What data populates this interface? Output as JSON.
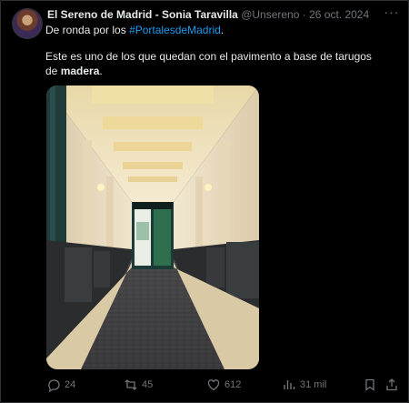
{
  "tweet": {
    "author_name": "El Sereno de Madrid - Sonia Taravilla",
    "handle": "@Unsereno",
    "separator": "·",
    "date": "26 oct. 2024",
    "more_label": "···",
    "line1_prefix": "De ronda por los ",
    "line1_hashtag": "#PortalesdeMadrid",
    "line1_suffix": ".",
    "line2_text": "Este es uno de los que quedan con el pavimento a base de tarugos de ",
    "line2_bold": "madera",
    "line2_suffix": "."
  },
  "actions": {
    "replies": "24",
    "reposts": "45",
    "likes": "612",
    "views": "31 mil"
  },
  "colors": {
    "background": "#000000",
    "text": "#e7e9ea",
    "muted": "#71767b",
    "link": "#1d9bf0"
  },
  "icons": [
    "reply-icon",
    "repost-icon",
    "like-icon",
    "views-icon",
    "bookmark-icon",
    "share-icon",
    "more-icon"
  ]
}
